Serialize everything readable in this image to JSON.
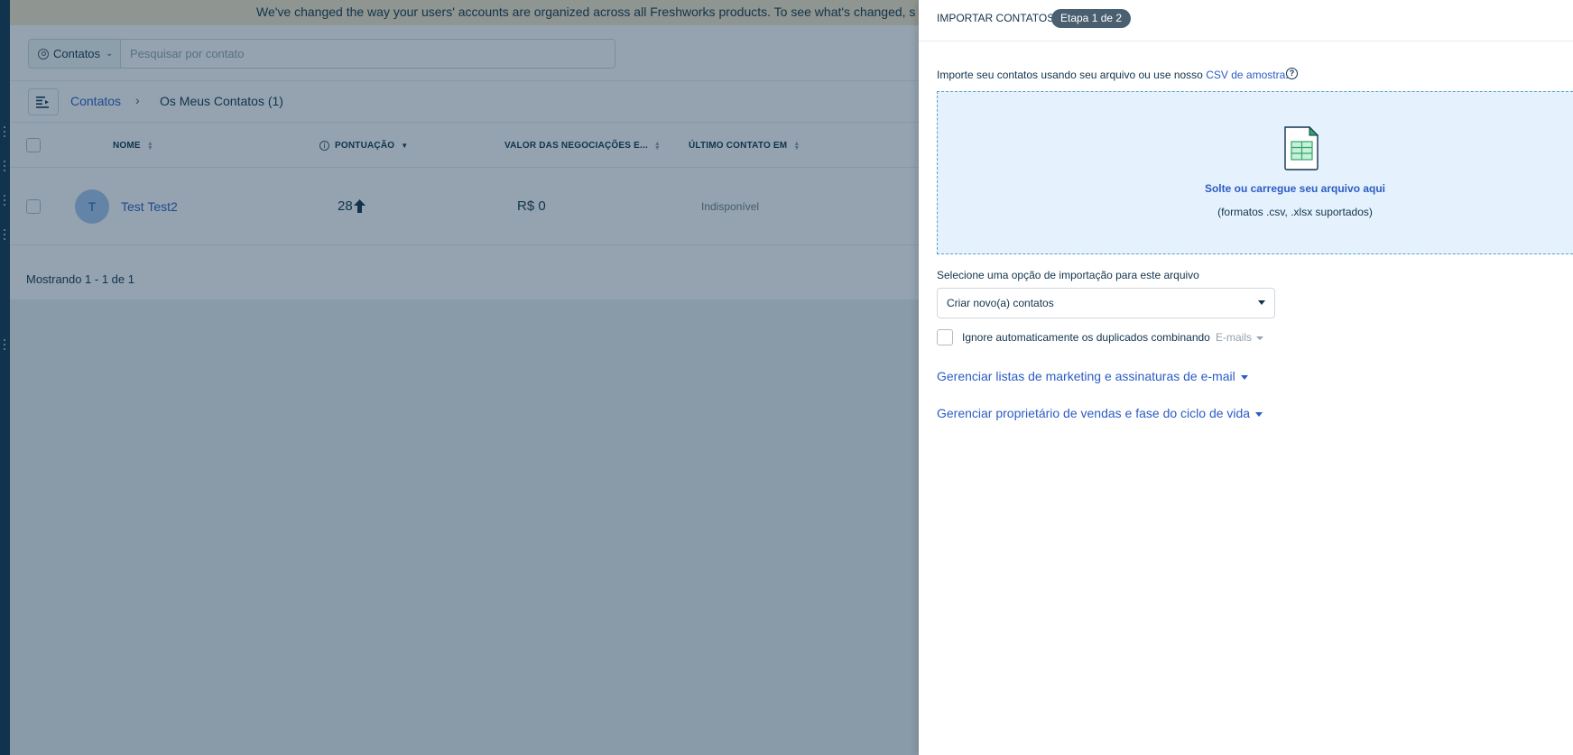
{
  "banner": {
    "text": "We've changed the way your users' accounts are organized across all Freshworks products. To see what's changed, s"
  },
  "search": {
    "scope_label": "Contatos",
    "placeholder": "Pesquisar por contato"
  },
  "breadcrumb": {
    "root": "Contatos",
    "current": "Os Meus Contatos (1)"
  },
  "table": {
    "columns": [
      "NOME",
      "PONTUAÇÃO",
      "VALOR DAS NEGOCIAÇÕES E...",
      "ÚLTIMO CONTATO EM"
    ],
    "rows": [
      {
        "avatar_initial": "T",
        "name": "Test Test2",
        "score": "28",
        "deal_value": "R$ 0",
        "last_contact": "Indisponível"
      }
    ],
    "footer": "Mostrando 1 - 1 de 1"
  },
  "import_panel": {
    "title": "IMPORTAR CONTATOS",
    "step_badge": "Etapa 1 de 2",
    "intro_text": "Importe seu contatos usando seu arquivo ou use nosso",
    "sample_link": "CSV de amostra",
    "intro_period": ".",
    "dropzone_title": "Solte ou carregue seu arquivo aqui",
    "dropzone_subtitle": "(formatos .csv, .xlsx suportados)",
    "option_label": "Selecione uma opção de importação para este arquivo",
    "option_value": "Criar novo(a) contatos",
    "dedupe_label": "Ignore automaticamente os duplicados combinando",
    "dedupe_field": "E-mails",
    "manage_marketing": "Gerenciar listas de marketing e assinaturas de e-mail",
    "manage_owner": "Gerenciar proprietário de vendas e fase do ciclo de vida"
  },
  "colors": {
    "brand_dark": "#12344d",
    "link": "#2c5cc5",
    "banner": "#f6e6c7",
    "dropzone_bg": "#e5f2fd"
  },
  "icons": [
    "user-circle-icon",
    "chevron-down-icon",
    "list-toggle-icon",
    "chevron-right-icon",
    "sort-icon",
    "info-icon",
    "arrow-up-icon",
    "help-icon",
    "spreadsheet-file-icon",
    "caret-down-icon"
  ]
}
